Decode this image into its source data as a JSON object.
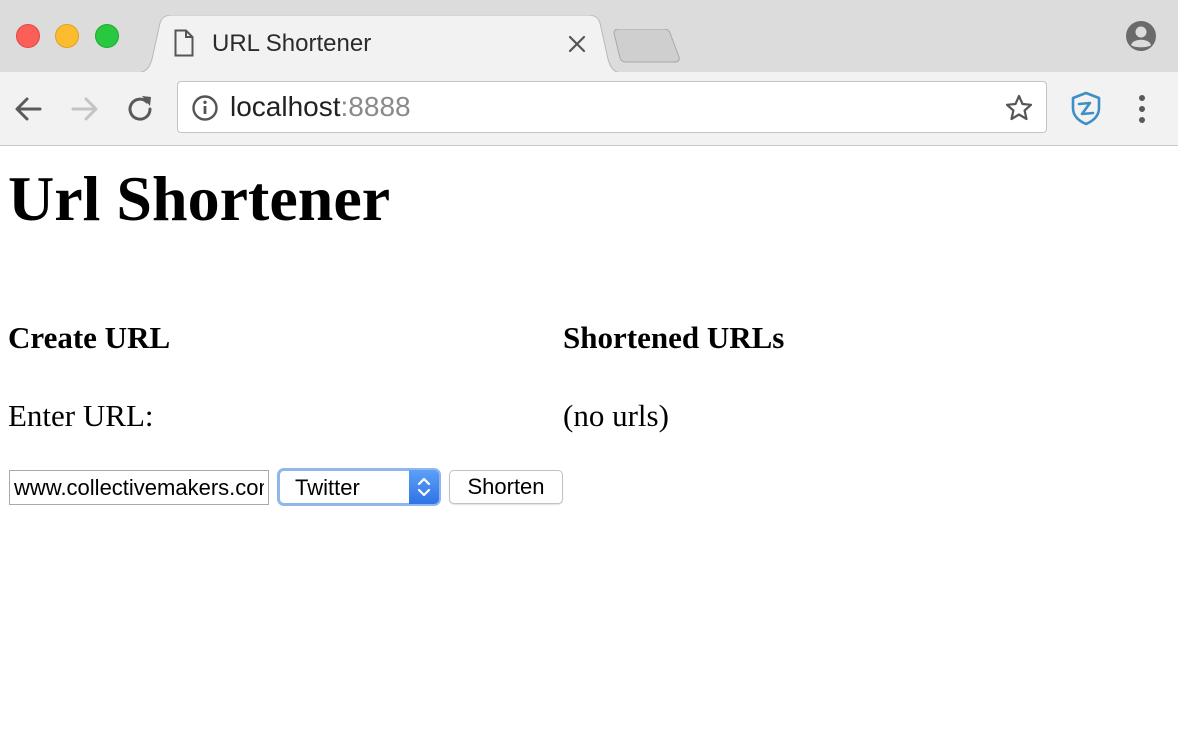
{
  "browser": {
    "tab_title": "URL Shortener",
    "address": {
      "host": "localhost",
      "port": ":8888"
    },
    "icons": {
      "tab": "document-icon",
      "close": "close-icon",
      "back": "back-arrow-icon",
      "forward": "forward-arrow-icon",
      "reload": "reload-icon",
      "info": "info-icon",
      "bookmark": "star-icon",
      "extension": "shield-extension-icon",
      "menu": "kebab-menu-icon",
      "profile": "profile-icon"
    }
  },
  "page": {
    "title": "Url Shortener",
    "create": {
      "heading": "Create URL",
      "label": "Enter URL:",
      "input_value": "www.collectivemakers.com",
      "select_value": "Twitter",
      "submit_label": "Shorten"
    },
    "list": {
      "heading": "Shortened URLs",
      "empty_text": "(no urls)"
    }
  },
  "colors": {
    "select_focus": "#8fb7ec",
    "select_arrow": "#2f73e6",
    "extension_icon": "#3e8fc6"
  }
}
